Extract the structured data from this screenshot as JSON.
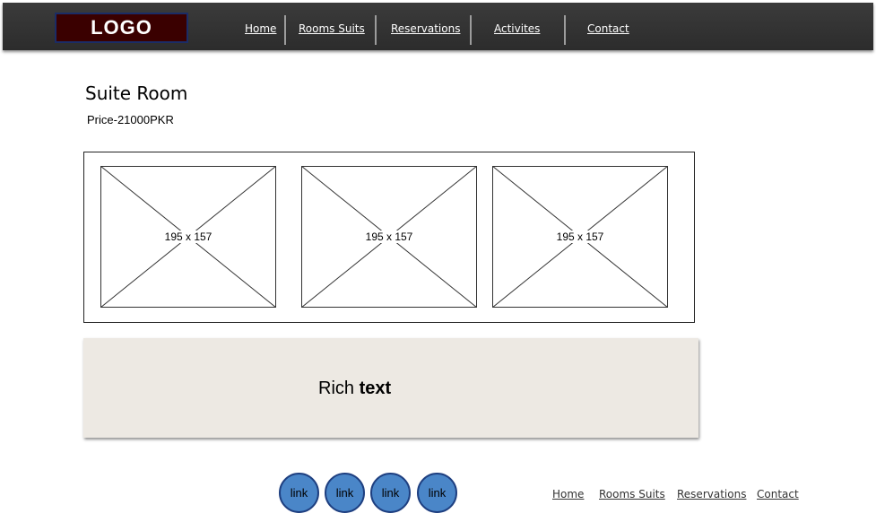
{
  "header": {
    "logo": "LOGO",
    "nav": [
      "Home",
      "Rooms Suits",
      "Reservations",
      "Activites",
      "Contact"
    ]
  },
  "room": {
    "title": "Suite Room",
    "price": "Price-21000PKR"
  },
  "gallery": {
    "placeholders": [
      "195 x 157",
      "195 x 157",
      "195 x 157"
    ]
  },
  "rich_text": {
    "normal": "Rich ",
    "bold": "text"
  },
  "footer": {
    "circle_links": [
      "link",
      "link",
      "link",
      "link"
    ],
    "links": [
      "Home",
      "Rooms Suits",
      "Reservations",
      "Contact"
    ]
  },
  "colors": {
    "header_bg": "#333333",
    "logo_bg": "#3a0000",
    "circle": "#4a86c8",
    "rich_bg": "#ede9e3"
  }
}
